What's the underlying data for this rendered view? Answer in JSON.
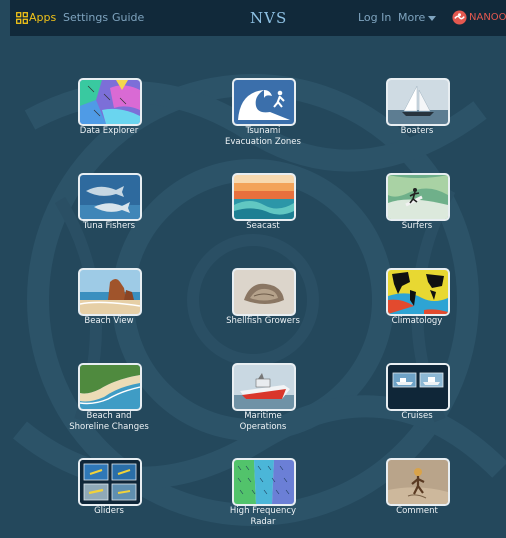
{
  "header": {
    "apps_label": "Apps",
    "settings_label": "Settings",
    "guide_label": "Guide",
    "brand": "NVS",
    "login_label": "Log In",
    "more_label": "More",
    "org_label": "NANOO"
  },
  "apps": [
    {
      "label": "Data Explorer",
      "icon": "data-explorer-icon"
    },
    {
      "label": "Tsunami\nEvacuation Zones",
      "icon": "tsunami-icon"
    },
    {
      "label": "Boaters",
      "icon": "sailboat-icon"
    },
    {
      "label": "Tuna Fishers",
      "icon": "tuna-icon"
    },
    {
      "label": "Seacast",
      "icon": "sunset-wave-icon"
    },
    {
      "label": "Surfers",
      "icon": "surfer-icon"
    },
    {
      "label": "Beach View",
      "icon": "beach-rock-icon"
    },
    {
      "label": "Shellfish Growers",
      "icon": "oyster-icon"
    },
    {
      "label": "Climatology",
      "icon": "world-map-icon"
    },
    {
      "label": "Beach and\nShoreline Changes",
      "icon": "shoreline-icon"
    },
    {
      "label": "Maritime\nOperations",
      "icon": "rescue-boat-icon"
    },
    {
      "label": "Cruises",
      "icon": "research-ship-icon"
    },
    {
      "label": "Gliders",
      "icon": "glider-icon"
    },
    {
      "label": "High Frequency\nRadar",
      "icon": "hf-radar-icon"
    },
    {
      "label": "Comment",
      "icon": "comment-icon"
    }
  ],
  "colors": {
    "background": "#24485c",
    "header": "#11293a",
    "apps_accent": "#f2c318",
    "brand": "#8ec1e3",
    "org": "#e4584f"
  }
}
